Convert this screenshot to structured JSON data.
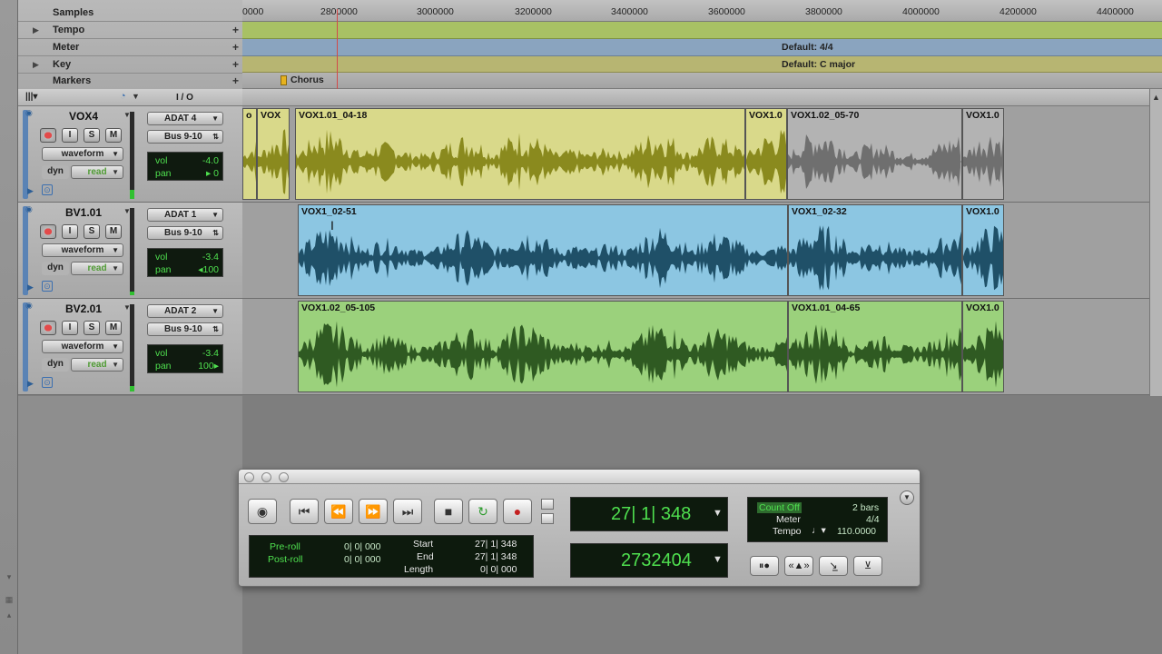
{
  "rulers": {
    "samples": "Samples",
    "tempo": "Tempo",
    "meter": "Meter",
    "key": "Key",
    "markers": "Markers",
    "meter_value": "Default: 4/4",
    "key_value": "Default: C major",
    "marker_name": "Chorus",
    "ticks": [
      "0000",
      "2800000",
      "3000000",
      "3200000",
      "3400000",
      "3600000",
      "3800000",
      "4000000",
      "4200000",
      "4400000"
    ]
  },
  "header": {
    "io_label": "I / O"
  },
  "tracks": [
    {
      "name": "VOX4",
      "input": "ADAT 4",
      "output": "Bus 9-10",
      "view": "waveform",
      "dyn": "dyn",
      "automation": "read",
      "vol_label": "vol",
      "vol": "-4.0",
      "pan_label": "pan",
      "pan": "▸ 0",
      "rec": "",
      "input_mon": "I",
      "solo": "S",
      "mute": "M"
    },
    {
      "name": "BV1.01",
      "input": "ADAT 1",
      "output": "Bus 9-10",
      "view": "waveform",
      "dyn": "dyn",
      "automation": "read",
      "vol_label": "vol",
      "vol": "-3.4",
      "pan_label": "pan",
      "pan": "◂100",
      "rec": "",
      "input_mon": "I",
      "solo": "S",
      "mute": "M"
    },
    {
      "name": "BV2.01",
      "input": "ADAT 2",
      "output": "Bus 9-10",
      "view": "waveform",
      "dyn": "dyn",
      "automation": "read",
      "vol_label": "vol",
      "vol": "-3.4",
      "pan_label": "pan",
      "pan": "100▸",
      "rec": "",
      "input_mon": "I",
      "solo": "S",
      "mute": "M"
    }
  ],
  "regions": {
    "track1": [
      "o",
      "VOX",
      "VOX1.01_04-18",
      "VOX1.0",
      "VOX1.02_05-70",
      "VOX1.0"
    ],
    "track2": [
      "VOX1_02-51",
      "VOX1_02-32",
      "VOX1.0"
    ],
    "track3": [
      "VOX1.02_05-105",
      "VOX1.01_04-65",
      "VOX1.0"
    ]
  },
  "colors": {
    "vox_region": "#d9d98a",
    "vox_wave": "#8a8a1e",
    "vox_inactive": "#b3b3b3",
    "bv1_region": "#8cc6e2",
    "bv1_wave": "#1f5068",
    "bv2_region": "#9bd17c",
    "bv2_wave": "#2f5a22",
    "playhead": "#d24a4a"
  },
  "transport": {
    "preroll_label": "Pre-roll",
    "postroll_label": "Post-roll",
    "preroll": "0| 0| 000",
    "postroll": "0| 0| 000",
    "start_label": "Start",
    "end_label": "End",
    "length_label": "Length",
    "start": "27| 1| 348",
    "end": "27| 1| 348",
    "length": "0| 0| 000",
    "main_counter": "27| 1| 348",
    "sub_counter": "2732404",
    "count_off_label": "Count Off",
    "count_off_value": "2 bars",
    "meter_label": "Meter",
    "meter_value": "4/4",
    "tempo_label": "Tempo",
    "tempo_value": "110.0000"
  }
}
